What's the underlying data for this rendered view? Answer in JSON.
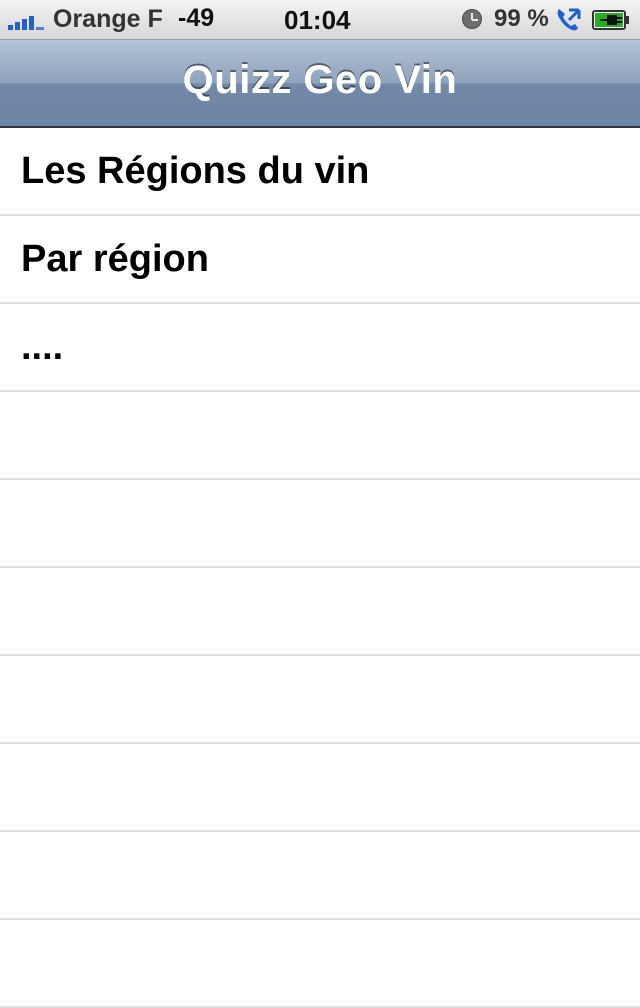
{
  "status_bar": {
    "carrier": "Orange F",
    "signal_value": "-49",
    "time": "01:04",
    "battery_percent": "99 %",
    "signal_icon": "signal-bars-icon",
    "alarm_icon": "alarm-clock-icon",
    "call_icon": "call-forwarding-icon",
    "battery_icon": "battery-charging-icon",
    "signal_color": "#2560c8",
    "battery_color": "#22b01e"
  },
  "nav_bar": {
    "title": "Quizz Geo Vin",
    "tint_color": "#7a90ae"
  },
  "menu": {
    "items": [
      {
        "label": "Les Régions du vin"
      },
      {
        "label": "Par région"
      },
      {
        "label": "...."
      },
      {
        "label": ""
      },
      {
        "label": ""
      },
      {
        "label": ""
      },
      {
        "label": ""
      },
      {
        "label": ""
      },
      {
        "label": ""
      },
      {
        "label": ""
      }
    ]
  }
}
